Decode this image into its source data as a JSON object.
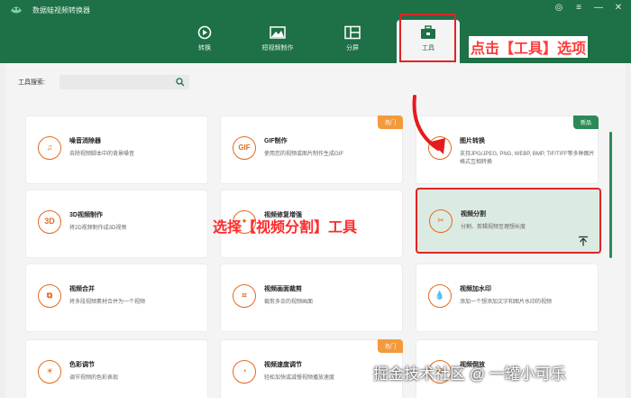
{
  "app": {
    "title": "数据蛙视频转换器"
  },
  "window": {
    "settings_glyph": "◎",
    "menu_glyph": "≡",
    "minimize_glyph": "—",
    "close_glyph": "✕"
  },
  "nav": {
    "items": [
      {
        "label": "转换",
        "icon": "convert-icon"
      },
      {
        "label": "短视频制作",
        "icon": "short-video-icon"
      },
      {
        "label": "分屏",
        "icon": "split-screen-icon"
      },
      {
        "label": "工具",
        "icon": "toolbox-icon",
        "active": true
      }
    ]
  },
  "search": {
    "label": "工具搜索:",
    "placeholder": ""
  },
  "annotations": {
    "nav_hint": "点击【工具】选项",
    "card_hint": "选择【视频分割】工具",
    "watermark": "掘金技术社区 @ 一罐小可乐"
  },
  "cards": [
    {
      "title": "噪音消除器",
      "desc": "去除视频脚本中的背景噪音",
      "icon": "noise-removal-icon",
      "glyph": "♫"
    },
    {
      "title": "GIF制作",
      "desc": "使用您的视频或图片制作生成GIF",
      "icon": "gif-icon",
      "glyph": "GIF",
      "badge": "热门"
    },
    {
      "title": "图片转换",
      "desc": "支持JPG/JPEG, PNG, WEBP, BMP, TIF/TIFF等多种图片格式互相转换",
      "icon": "image-convert-icon",
      "glyph": "◐",
      "badge": "新品"
    },
    {
      "title": "3D视频制作",
      "desc": "将2D视频制作成3D视频",
      "icon": "3d-icon",
      "glyph": "3D"
    },
    {
      "title": "视频修复增强",
      "desc": "",
      "icon": "enhance-icon",
      "glyph": "✦"
    },
    {
      "title": "视频分割",
      "desc": "分割、剪辑视频至理想长度",
      "icon": "scissors-icon",
      "glyph": "✂"
    },
    {
      "title": "视频合并",
      "desc": "将多段视频素材合并为一个视频",
      "icon": "merge-icon",
      "glyph": "⧉"
    },
    {
      "title": "视频画面裁剪",
      "desc": "裁剪多余的视频画面",
      "icon": "crop-icon",
      "glyph": "⌗"
    },
    {
      "title": "视频加水印",
      "desc": "添加一个想添加文字和图片水印的视频",
      "icon": "watermark-icon",
      "glyph": "💧"
    },
    {
      "title": "色彩调节",
      "desc": "调节视频的色彩表现",
      "icon": "color-icon",
      "glyph": "☀"
    },
    {
      "title": "视频速度调节",
      "desc": "轻松加快或减慢视频播放速度",
      "icon": "speed-icon",
      "glyph": "◔",
      "badge": "热门"
    },
    {
      "title": "视频倒放",
      "desc": "",
      "icon": "reverse-icon",
      "glyph": "⟲"
    }
  ],
  "colors": {
    "brand_green": "#1e7046",
    "accent_orange": "#e46a1f",
    "highlight_red": "#e02424"
  }
}
